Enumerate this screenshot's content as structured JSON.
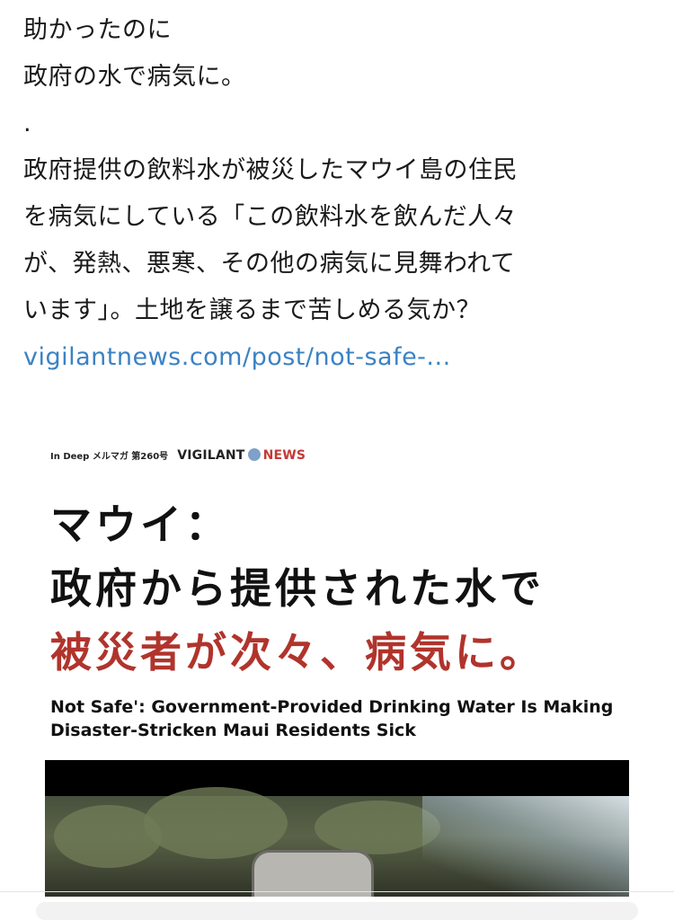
{
  "post": {
    "lines": [
      "助かったのに",
      "政府の水で病気に。",
      ".",
      "政府提供の飲料水が被災したマウイ島の住民",
      "を病気にしている「この飲料水を飲んだ人々",
      "が、発熱、悪寒、その他の病気に見舞われて",
      "います」。土地を譲るまで苦しめる気か？"
    ],
    "link_text": "vigilantnews.com/post/not-safe-..."
  },
  "card": {
    "header_small": "In Deep メルマガ 第260号",
    "header_brand_a": "VIGILANT",
    "header_brand_b": "NEWS",
    "headline_1": "マウイ：",
    "headline_2": "政府から提供された水で",
    "headline_3": "被災者が次々、病気に。",
    "subtitle": "Not Safe': Government-Provided Drinking Water Is Making Disaster-Stricken Maui Residents Sick"
  },
  "colors": {
    "link": "#3b82c4",
    "headline_red": "#b0342c",
    "text": "#1a1a1a"
  },
  "icons": {
    "brand_logo": "globe-icon"
  }
}
